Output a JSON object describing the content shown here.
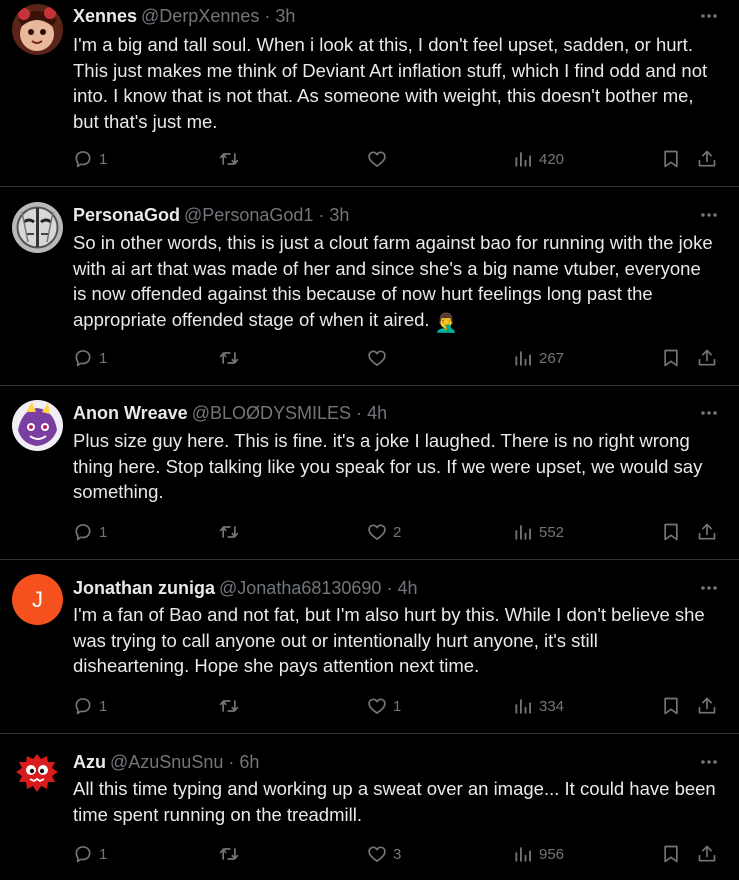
{
  "tweets": [
    {
      "name": "Xennes",
      "handle": "@DerpXennes",
      "time": "3h",
      "text": "I'm a big and tall soul. When i look at this, I don't feel upset, sadden, or hurt. This just makes me think of Deviant Art inflation stuff, which I find odd and not into. I know that is not that. As someone with weight, this doesn't bother me, but that's just me.",
      "replies": "1",
      "retweets": "",
      "likes": "",
      "views": "420",
      "avatar_icon": "cartoon-face-avatar"
    },
    {
      "name": "PersonaGod",
      "handle": "@PersonaGod1",
      "time": "3h",
      "text": "So in other words, this is just a clout farm against bao for running with the joke with ai art that was made of her and since she's a big name vtuber, everyone is now offended against this because of now hurt feelings long past the appropriate offended stage of when it aired.",
      "emoji": "🤦‍♂️",
      "replies": "1",
      "retweets": "",
      "likes": "",
      "views": "267",
      "avatar_icon": "mask-avatar"
    },
    {
      "name": "Anon Wreave",
      "handle": "@BLOØDYSMILES",
      "time": "4h",
      "text": "Plus size guy here. This is fine. it's a joke I laughed. There is no right wrong thing here. Stop talking like you speak for us. If we were upset, we would say something.",
      "replies": "1",
      "retweets": "",
      "likes": "2",
      "views": "552",
      "avatar_icon": "anime-character-avatar"
    },
    {
      "name": "Jonathan zuniga",
      "handle": "@Jonatha68130690",
      "time": "4h",
      "text": "I'm a fan of Bao and not fat, but I'm also hurt by this. While I don't believe she was trying to call anyone out or intentionally hurt anyone, it's still disheartening. Hope she pays attention next time.",
      "avatar_letter": "J",
      "replies": "1",
      "retweets": "",
      "likes": "1",
      "views": "334",
      "avatar_icon": "letter-avatar"
    },
    {
      "name": "Azu",
      "handle": "@AzuSnuSnu",
      "time": "6h",
      "text": "All this time typing and working up a sweat over an image... It could have been time spent running on the treadmill.",
      "replies": "1",
      "retweets": "",
      "likes": "3",
      "views": "956",
      "avatar_icon": "red-fluffy-creature-avatar"
    }
  ],
  "colors": {
    "background": "#000000",
    "text": "#e7e9ea",
    "secondary": "#71767b",
    "divider": "#2f3336",
    "letter_avatar": "#f4511e"
  },
  "separator": "·"
}
